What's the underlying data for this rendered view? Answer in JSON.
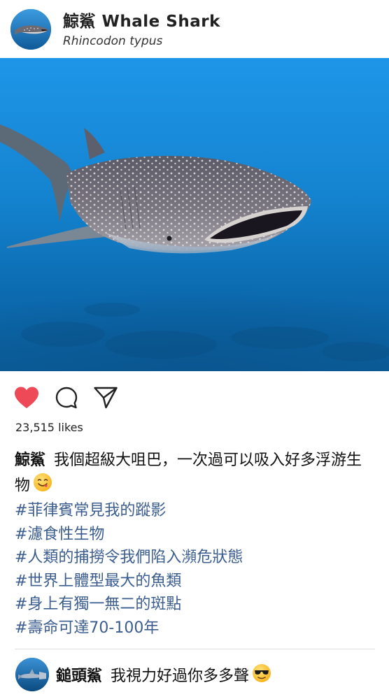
{
  "header": {
    "account_name": "鯨鯊 Whale Shark",
    "subtitle": "Rhincodon typus",
    "avatar_icon": "whale-shark-avatar"
  },
  "photo": {
    "subject_icon": "whale-shark-photo",
    "colors": {
      "water_top": "#1a8ee0",
      "water_bottom": "#0a5a9a"
    }
  },
  "actions": {
    "like_icon": "heart-icon",
    "comment_icon": "comment-icon",
    "share_icon": "send-icon",
    "liked": true,
    "like_color": "#ed4956"
  },
  "likes": {
    "text": "23,515 likes"
  },
  "caption": {
    "author": "鯨鯊",
    "text": "我個超級大咀巴，一次過可以吸入好多浮游生物",
    "emoji_icon": "yum-face-emoji"
  },
  "hashtags": [
    "#菲律賓常見我的蹤影",
    "#濾食性生物",
    "#人類的捕撈令我們陷入瀕危狀態",
    "#世界上體型最大的魚類",
    "#身上有獨一無二的斑點",
    "#壽命可達70-100年"
  ],
  "hashtag_color": "#3b5d8f",
  "comment": {
    "author": "鎚頭鯊",
    "text": "我視力好過你多多聲",
    "emoji_icon": "sunglasses-face-emoji",
    "avatar_icon": "hammerhead-shark-avatar"
  }
}
